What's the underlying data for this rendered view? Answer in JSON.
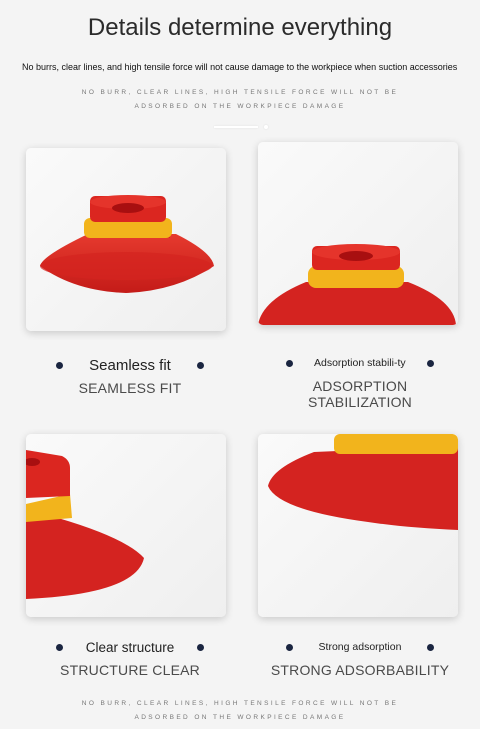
{
  "header": {
    "title": "Details determine everything",
    "subtitle": "No burrs, clear lines, and high tensile force will not cause damage to the workpiece when suction accessories",
    "caps_line1": "NO BURR, CLEAR LINES, HIGH TENSILE FORCE WILL NOT BE",
    "caps_line2": "ADSORBED ON THE WORKPIECE DAMAGE"
  },
  "features": [
    {
      "label": "Seamless fit",
      "caps": "SEAMLESS FIT"
    },
    {
      "label": "Adsorption stabili-ty",
      "caps": "ADSORPTION STABILIZATION"
    },
    {
      "label": "Clear structure",
      "caps": "STRUCTURE CLEAR"
    },
    {
      "label": "Strong adsorption",
      "caps": "STRONG ADSORBABILITY"
    }
  ],
  "footer": {
    "caps_line1": "NO BURR, CLEAR LINES, HIGH TENSILE FORCE WILL NOT BE",
    "caps_line2": "ADSORBED ON THE WORKPIECE DAMAGE"
  },
  "colors": {
    "background": "#f4f4f4",
    "cup_red": "#d92222",
    "cup_red_dark": "#b01616",
    "ring_yellow": "#f2b41c",
    "bullet": "#1a2540"
  }
}
